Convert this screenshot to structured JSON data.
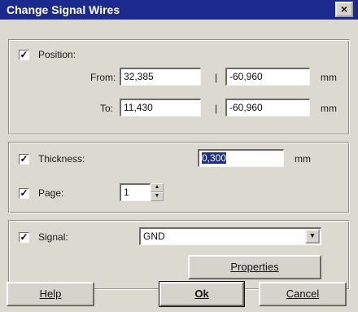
{
  "window": {
    "title": "Change Signal Wires",
    "close_label": "×"
  },
  "position": {
    "checked": true,
    "label": "Position:",
    "from_label": "From:",
    "to_label": "To:",
    "separator": "|",
    "from_x": "32,385",
    "from_y": "-60,960",
    "to_x": "11,430",
    "to_y": "-60,960",
    "unit": "mm"
  },
  "thickness": {
    "checked": true,
    "label": "Thickness:",
    "value": "0,300",
    "unit": "mm"
  },
  "page": {
    "checked": true,
    "label": "Page:",
    "value": "1"
  },
  "signal": {
    "checked": true,
    "label": "Signal:",
    "value": "GND",
    "properties_button": "Properties"
  },
  "buttons": {
    "help": "Help",
    "ok": "Ok",
    "cancel": "Cancel"
  }
}
